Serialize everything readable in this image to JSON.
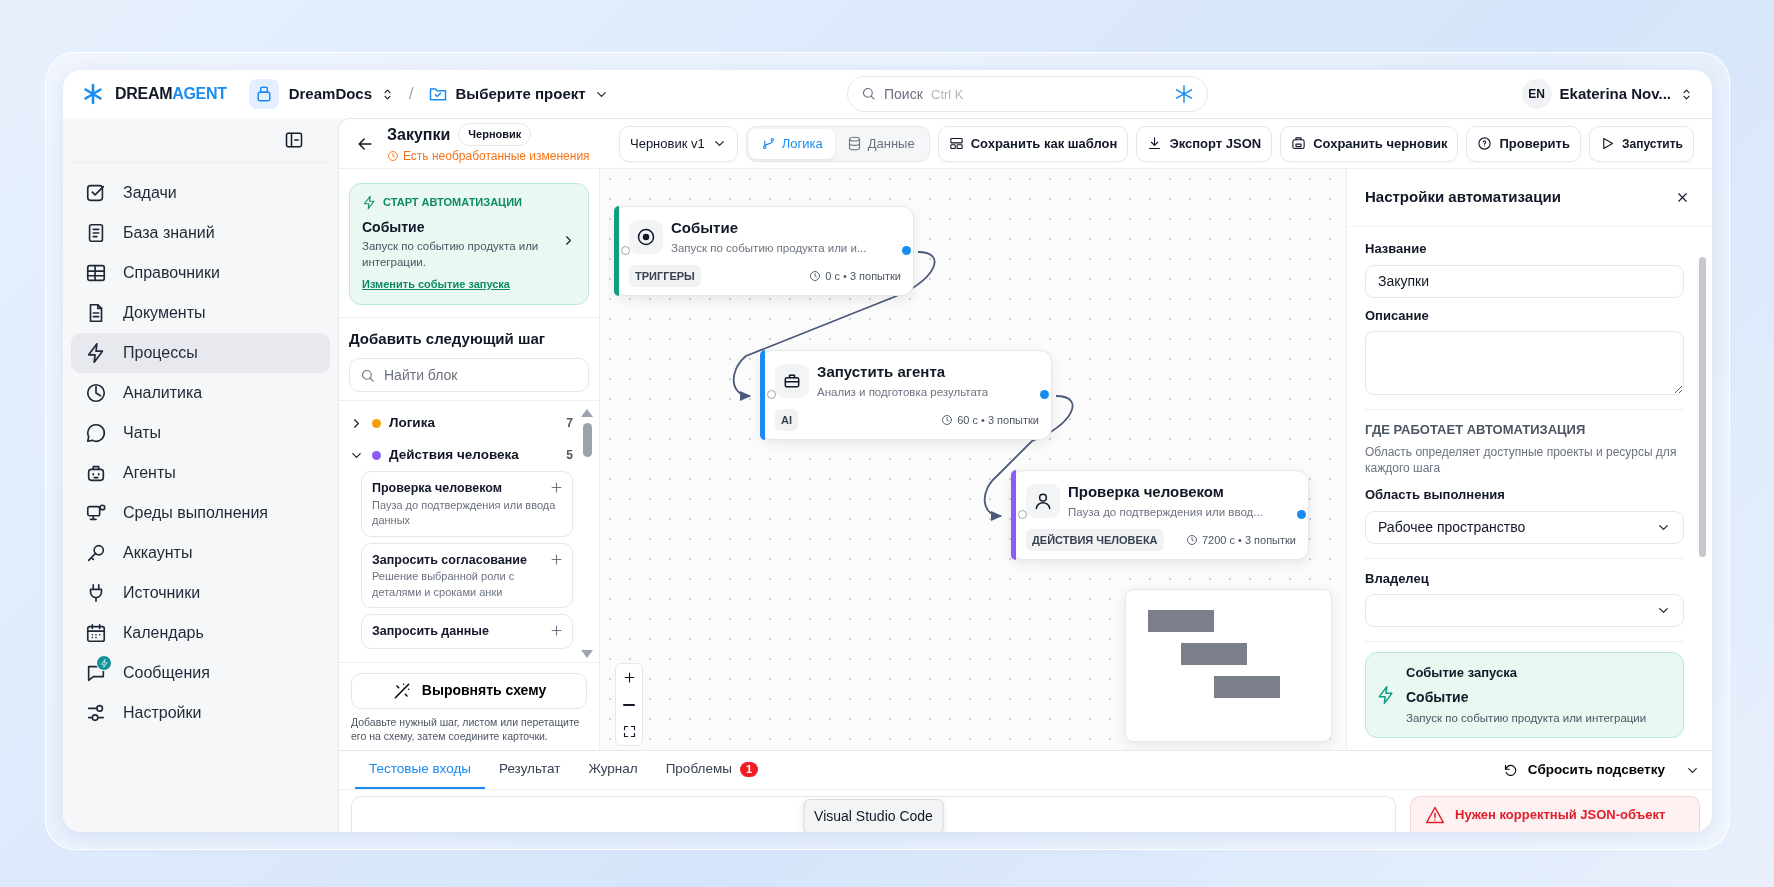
{
  "header": {
    "logo": {
      "main": "DREAM",
      "accent": "AGENT"
    },
    "workspace": "DreamDocs",
    "separator": "/",
    "project": "Выберите проект",
    "search": {
      "placeholder": "Поиск",
      "shortcut": "Ctrl K"
    },
    "user": {
      "initials": "EN",
      "name": "Ekaterina Nov..."
    }
  },
  "sidebar": {
    "items": [
      {
        "label": "Задачи",
        "selected": false,
        "badge": false
      },
      {
        "label": "База знаний",
        "selected": false,
        "badge": false
      },
      {
        "label": "Справочники",
        "selected": false,
        "badge": false
      },
      {
        "label": "Документы",
        "selected": false,
        "badge": false
      },
      {
        "label": "Процессы",
        "selected": true,
        "badge": false
      },
      {
        "label": "Аналитика",
        "selected": false,
        "badge": false
      },
      {
        "label": "Чаты",
        "selected": false,
        "badge": false
      },
      {
        "label": "Агенты",
        "selected": false,
        "badge": false
      },
      {
        "label": "Среды выполнения",
        "selected": false,
        "badge": false
      },
      {
        "label": "Аккаунты",
        "selected": false,
        "badge": false
      },
      {
        "label": "Источники",
        "selected": false,
        "badge": false
      },
      {
        "label": "Календарь",
        "selected": false,
        "badge": false
      },
      {
        "label": "Сообщения",
        "selected": false,
        "badge": true
      },
      {
        "label": "Настройки",
        "selected": false,
        "badge": false
      }
    ]
  },
  "flow": {
    "title": "Закупки",
    "status": "Черновик",
    "warning": "Есть необработанные изменения",
    "version": "Черновик v1",
    "views": [
      {
        "label": "Логика",
        "selected": true
      },
      {
        "label": "Данные",
        "selected": false
      }
    ],
    "actions": [
      "Сохранить как шаблон",
      "Экспорт JSON",
      "Сохранить черновик",
      "Проверить",
      "Запустить"
    ]
  },
  "palette": {
    "trigger": {
      "label": "СТАРТ АВТОМАТИЗАЦИИ",
      "title": "Событие",
      "description": "Запуск по событию продукта или интеграции.",
      "link": "Изменить событие запуска"
    },
    "heading": "Добавить следующий шаг",
    "search_placeholder": "Найти блок",
    "groups": [
      {
        "name": "Логика",
        "count": "7",
        "color": "#f59e0b",
        "expanded": false
      },
      {
        "name": "Действия человека",
        "count": "5",
        "color": "#8b5cf6",
        "expanded": true,
        "children": [
          {
            "title": "Проверка человеком",
            "description": "Пауза до подтверждения или ввода данных"
          },
          {
            "title": "Запросить согласование",
            "description": "Решение выбранной роли с деталями и сроками анки"
          },
          {
            "title": "Запросить данные"
          }
        ]
      }
    ],
    "align_button": "Выровнять схему",
    "hint": "Добавьте нужный шаг, листом или перетащите его на схему, затем соедините карточки."
  },
  "canvas": {
    "nodes": [
      {
        "title": "Событие",
        "description": "Запуск по событию продукта или и...",
        "tag": "ТРИГГЕРЫ",
        "meta": "0 с • 3 попытки",
        "color": "#0f9f7f"
      },
      {
        "title": "Запустить агента",
        "description": "Анализ и подготовка результата",
        "tag": "AI",
        "meta": "60 с • 3 попытки",
        "color": "#1e88f5"
      },
      {
        "title": "Проверка человеком",
        "description": "Пауза до подтверждения или ввод...",
        "tag": "ДЕЙСТВИЯ ЧЕЛОВЕКА",
        "meta": "7200 с • 3 попытки",
        "color": "#8b5cf6"
      }
    ]
  },
  "settings": {
    "title": "Настройки автоматизации",
    "fields": [
      {
        "kind": "text",
        "label": "Название",
        "value": "Закупки"
      },
      {
        "kind": "textarea",
        "label": "Описание"
      },
      {
        "kind": "section",
        "heading": "ГДЕ РАБОТАЕТ АВТОМАТИЗАЦИЯ",
        "description": "Область определяет доступные проекты и ресурсы для каждого шага"
      },
      {
        "kind": "select",
        "label": "Область выполнения",
        "value": "Рабочее пространство"
      },
      {
        "kind": "select",
        "label": "Владелец"
      }
    ],
    "trigger": {
      "label": "Событие запуска",
      "title": "Событие",
      "description": "Запуск по событию продукта или интеграции"
    }
  },
  "bottom": {
    "tabs": [
      {
        "label": "Тестовые входы",
        "selected": true
      },
      {
        "label": "Результат",
        "selected": false
      },
      {
        "label": "Журнал",
        "selected": false
      },
      {
        "label": "Проблемы",
        "selected": false,
        "count": "1"
      }
    ],
    "reset": "Сбросить подсветку",
    "tooltip": "Visual Studio Code",
    "error": "Нужен корректный JSON-объект"
  }
}
